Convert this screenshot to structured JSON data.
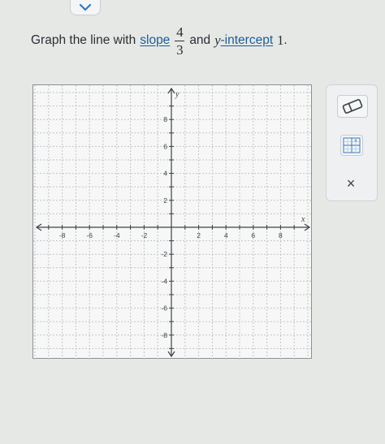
{
  "header": {
    "collapse_icon": "chevron-down-icon"
  },
  "question": {
    "prefix": "Graph the line with",
    "slope_link": "slope",
    "slope_numerator": "4",
    "slope_denominator": "3",
    "and_text": "and",
    "intercept_var": "y",
    "intercept_link": "-intercept",
    "intercept_value": "1",
    "period": "."
  },
  "graph": {
    "x_axis_label": "x",
    "y_axis_label": "y",
    "x_range": [
      -10,
      10
    ],
    "y_range": [
      -10,
      10
    ],
    "x_tick_labels": [
      "-8",
      "-6",
      "-4",
      "-2",
      "2",
      "4",
      "6",
      "8"
    ],
    "y_tick_labels": [
      "8",
      "6",
      "4",
      "2",
      "-2",
      "-4",
      "-6",
      "-8"
    ],
    "grid": true
  },
  "tools": {
    "eraser_icon": "eraser-icon",
    "line_tool_icon": "graph-line-tool-icon",
    "close_label": "×",
    "close_icon": "close-icon"
  },
  "colors": {
    "link": "#1a5d9a",
    "axis": "#3d4248",
    "grid": "#c2c6ca"
  }
}
